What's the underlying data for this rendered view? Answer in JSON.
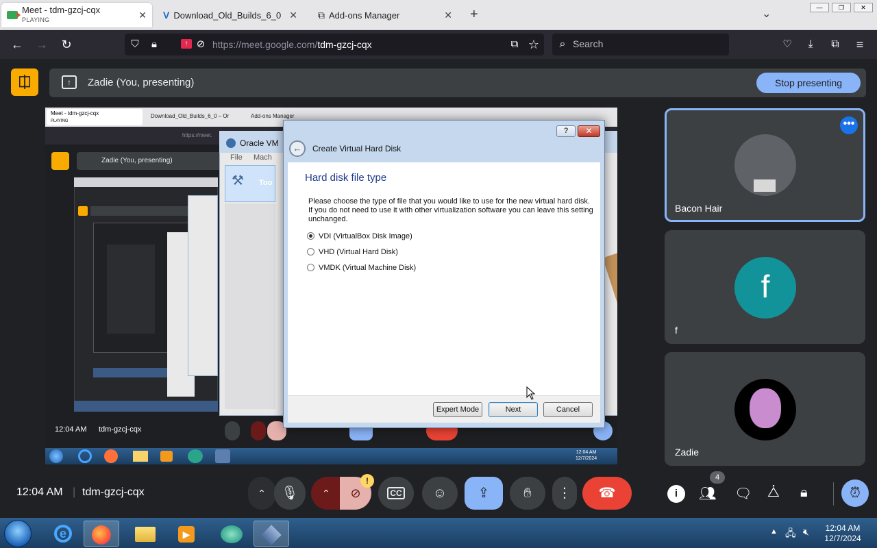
{
  "browser": {
    "tabs": [
      {
        "title": "Meet - tdm-gzcj-cqx",
        "status": "PLAYING"
      },
      {
        "title": "Download_Old_Builds_6_0 – Or"
      },
      {
        "title": "Add-ons Manager"
      }
    ],
    "url_prefix": "https://meet.google.com/",
    "url_path": "tdm-gzcj-cqx",
    "search_placeholder": "Search"
  },
  "meet": {
    "presenting_label": "Zadie (You, presenting)",
    "stop_presenting": "Stop presenting",
    "participants": [
      {
        "name": "Bacon Hair"
      },
      {
        "name": "f",
        "initial": "f",
        "color": "#12939a"
      },
      {
        "name": "Zadie"
      }
    ],
    "time": "12:04 AM",
    "meeting_code": "tdm-gzcj-cqx",
    "people_count": "4"
  },
  "shared": {
    "tab1": "Meet - tdm-gzcj-cqx",
    "tab1_status": "PLAYING",
    "tab2": "Download_Old_Builds_6_0 – Or",
    "tab3": "Add-ons Manager",
    "url": "https://meet.",
    "presenting": "Zadie (You, presenting)",
    "vbox_title": "Oracle VM",
    "menu_file": "File",
    "menu_mach": "Mach",
    "tools_label": "Too",
    "inner_time": "12:04 AM",
    "inner_code": "tdm-gzcj-cqx",
    "tray_time": "12:04 AM",
    "tray_date": "12/7/2024"
  },
  "dialog": {
    "title": "Create Virtual Hard Disk",
    "heading": "Hard disk file type",
    "description": "Please choose the type of file that you would like to use for the new virtual hard disk. If you do not need to use it with other virtualization software you can leave this setting unchanged.",
    "options": [
      "VDI (VirtualBox Disk Image)",
      "VHD (Virtual Hard Disk)",
      "VMDK (Virtual Machine Disk)"
    ],
    "selected": 0,
    "expert_mode": "Expert Mode",
    "next": "Next",
    "cancel": "Cancel",
    "help": "?"
  },
  "taskbar": {
    "time": "12:04 AM",
    "date": "12/7/2024"
  }
}
